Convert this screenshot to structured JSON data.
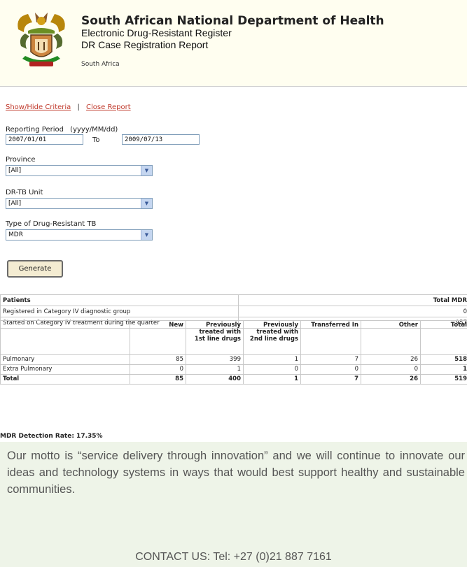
{
  "header": {
    "title": "South African National Department of Health",
    "subtitle1": "Electronic Drug-Resistant Register",
    "subtitle2": "DR Case Registration Report",
    "country": "South Africa"
  },
  "links": {
    "show_hide": "Show/Hide Criteria",
    "separator": "|",
    "close": "Close Report"
  },
  "criteria": {
    "period_label": "Reporting Period",
    "period_format": "(yyyy/MM/dd)",
    "from_value": "2007/01/01",
    "to_label": "To",
    "to_value": "2009/07/13",
    "province_label": "Province",
    "province_value": "[All]",
    "unit_label": "DR-TB Unit",
    "unit_value": "[All]",
    "type_label": "Type of Drug-Resistant TB",
    "type_value": "MDR",
    "generate_label": "Generate"
  },
  "patients_table": {
    "header": "Patients",
    "total_header": "Total MDR",
    "rows": [
      {
        "label": "Registered in Category IV diagnostic group",
        "value": "0"
      },
      {
        "label": "Started on Category IV treatment during the quarter",
        "value": "957"
      }
    ]
  },
  "case_table": {
    "columns": [
      "New",
      "Previously treated with 1st line drugs",
      "Previously treated with 2nd line drugs",
      "Transferred In",
      "Other",
      "Total"
    ],
    "rows": [
      {
        "label": "Pulmonary",
        "values": [
          "85",
          "399",
          "1",
          "7",
          "26",
          "518"
        ]
      },
      {
        "label": "Extra Pulmonary",
        "values": [
          "0",
          "1",
          "0",
          "0",
          "0",
          "1"
        ]
      },
      {
        "label": "Total",
        "values": [
          "85",
          "400",
          "1",
          "7",
          "26",
          "519"
        ]
      }
    ]
  },
  "detection": "MDR Detection Rate: 17.35%",
  "footer": {
    "motto": "Our motto is “service delivery through innovation” and we will continue to innovate our ideas and technology systems in ways that would best support healthy and sustainable communities.",
    "contact": "CONTACT US: Tel: +27 (0)21 887 7161"
  },
  "icons": {
    "crest": "coat-of-arms-icon",
    "dropdown": "chevron-down-icon"
  },
  "colors": {
    "link": "#c0392b",
    "header_bg": "#fffef0",
    "page_bg": "#eef4e8"
  }
}
